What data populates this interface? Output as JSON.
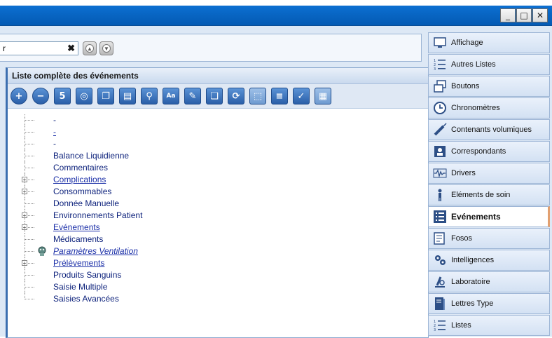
{
  "window": {
    "title_overflow": "……………………………………",
    "minimize": "_",
    "maximize": "□",
    "close": "✕"
  },
  "search": {
    "value": "r",
    "placeholder": "",
    "clear": "✖"
  },
  "panel": {
    "title": "Liste complète des événements"
  },
  "toolbar": [
    {
      "name": "add-icon",
      "glyph": "+"
    },
    {
      "name": "remove-icon",
      "glyph": "−"
    },
    {
      "name": "form-icon",
      "glyph": "5"
    },
    {
      "name": "globe-icon",
      "glyph": "◎"
    },
    {
      "name": "copy-icon",
      "glyph": "❐"
    },
    {
      "name": "paste-icon",
      "glyph": "▤"
    },
    {
      "name": "link-icon",
      "glyph": "⚲"
    },
    {
      "name": "font-icon",
      "glyph": "Aa"
    },
    {
      "name": "edit-icon",
      "glyph": "✎"
    },
    {
      "name": "windows-icon",
      "glyph": "❏"
    },
    {
      "name": "refresh-icon",
      "glyph": "⟳"
    },
    {
      "name": "select-icon",
      "glyph": "⬚"
    },
    {
      "name": "align-icon",
      "glyph": "≡"
    },
    {
      "name": "validate-icon",
      "glyph": "✓"
    },
    {
      "name": "grid-icon",
      "glyph": "▦"
    }
  ],
  "tree": [
    {
      "label": "-",
      "expandable": false,
      "style": ""
    },
    {
      "label": "-",
      "expandable": false,
      "style": "u"
    },
    {
      "label": "-",
      "expandable": false,
      "style": ""
    },
    {
      "label": "Balance Liquidienne",
      "expandable": false,
      "style": ""
    },
    {
      "label": "Commentaires",
      "expandable": false,
      "style": ""
    },
    {
      "label": "Complications",
      "expandable": true,
      "style": "u"
    },
    {
      "label": "Consommables",
      "expandable": true,
      "style": ""
    },
    {
      "label": "Donnée Manuelle",
      "expandable": false,
      "style": ""
    },
    {
      "label": "Environnements Patient",
      "expandable": true,
      "style": ""
    },
    {
      "label": "Evénements",
      "expandable": true,
      "style": "u"
    },
    {
      "label": "Médicaments",
      "expandable": false,
      "style": ""
    },
    {
      "label": "Paramètres Ventilation",
      "expandable": false,
      "style": "u i",
      "icon": "ventilator-icon"
    },
    {
      "label": "Prélèvements",
      "expandable": true,
      "style": "u"
    },
    {
      "label": "Produits Sanguins",
      "expandable": false,
      "style": ""
    },
    {
      "label": "Saisie Multiple",
      "expandable": false,
      "style": ""
    },
    {
      "label": "Saisies Avancées",
      "expandable": false,
      "style": ""
    }
  ],
  "sidebar": {
    "items": [
      {
        "label": "Affichage",
        "icon": "monitor-icon",
        "active": false
      },
      {
        "label": "Autres Listes",
        "icon": "numbered-list-icon",
        "active": false
      },
      {
        "label": "Boutons",
        "icon": "windows-icon",
        "active": false
      },
      {
        "label": "Chronomètres",
        "icon": "clock-icon",
        "active": false
      },
      {
        "label": "Contenants volumiques",
        "icon": "syringe-icon",
        "active": false
      },
      {
        "label": "Correspondants",
        "icon": "contact-card-icon",
        "active": false
      },
      {
        "label": "Drivers",
        "icon": "waveform-icon",
        "active": false
      },
      {
        "label": "Eléments de soin",
        "icon": "person-icon",
        "active": false
      },
      {
        "label": "Evénements",
        "icon": "list-icon",
        "active": true
      },
      {
        "label": "Fosos",
        "icon": "form-edit-icon",
        "active": false
      },
      {
        "label": "Intelligences",
        "icon": "gear-cluster-icon",
        "active": false
      },
      {
        "label": "Laboratoire",
        "icon": "microscope-icon",
        "active": false
      },
      {
        "label": "Lettres Type",
        "icon": "book-icon",
        "active": false
      },
      {
        "label": "Listes",
        "icon": "numbered-list-icon",
        "active": false
      }
    ]
  },
  "colors": {
    "titlebar": "#0a64c8",
    "tree_text": "#0a1f7a",
    "active_accent": "#e2a070"
  }
}
